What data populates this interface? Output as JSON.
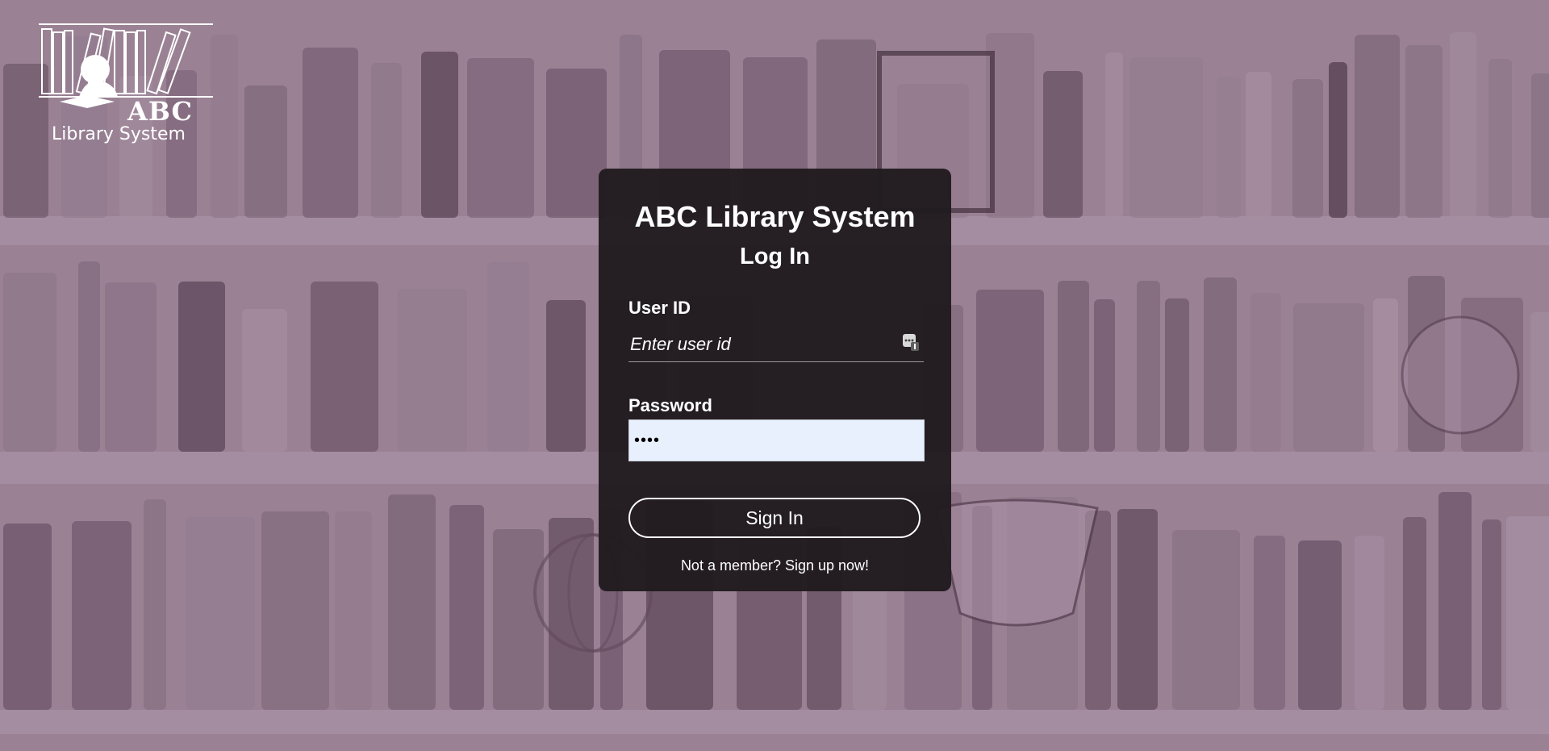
{
  "app": {
    "logo_abc": "ABC",
    "logo_subtitle": "Library System"
  },
  "login": {
    "title": "ABC Library System",
    "subtitle": "Log In",
    "user_id_label": "User ID",
    "user_id_placeholder": "Enter user id",
    "user_id_value": "",
    "password_label": "Password",
    "password_value": "••••",
    "sign_in_label": "Sign In",
    "signup_text": "Not a member? Sign up now!"
  },
  "colors": {
    "background_tint": "#9c8a98",
    "card_background": "#201b1f",
    "autofill_field": "#e8f0fe",
    "text": "#ffffff"
  },
  "icons": {
    "autofill": "password-manager-key-icon",
    "logo": "reader-with-bookshelf-logo-icon"
  }
}
